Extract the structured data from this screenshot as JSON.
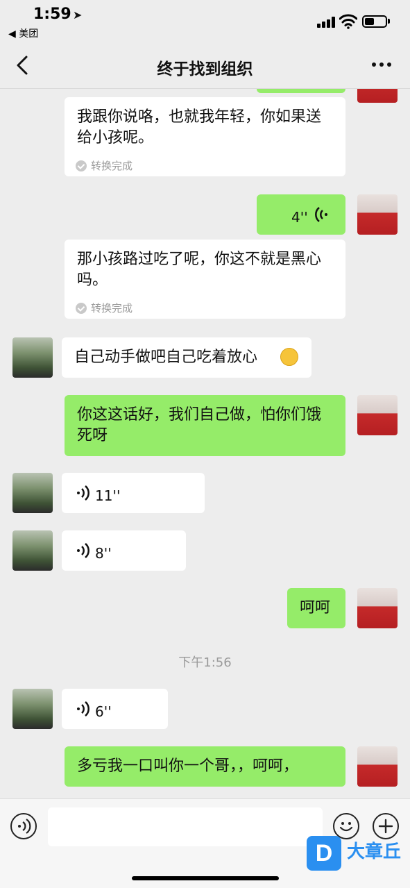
{
  "status_bar": {
    "time": "1:59",
    "location_arrow": "➤",
    "back_app": "◀ 美团"
  },
  "nav": {
    "title": "终于找到组织"
  },
  "messages": {
    "conv1_text": "我跟你说咯，也就我年轻，你如果送给小孩呢。",
    "conv1_status": "转换完成",
    "voice_me_duration": "4''",
    "conv2_text": "那小孩路过吃了呢，你这不就是黑心吗。",
    "conv2_status": "转换完成",
    "other_text1": "自己动手做吧自己吃着放心",
    "me_text1": "你这这话好，我们自己做，怕你们饿死呀",
    "voice_other1_duration": "11''",
    "voice_other2_duration": "8''",
    "me_text2": "呵呵",
    "timestamp": "下午1:56",
    "voice_other3_duration": "6''",
    "me_text3": "多亏我一口叫你一个哥，，呵呵，"
  },
  "input_bar": {
    "placeholder": ""
  },
  "watermark": {
    "logo_letter": "D",
    "text": "大章丘"
  },
  "colors": {
    "background": "#ededed",
    "bubble_me": "#95ec69",
    "bubble_other": "#ffffff",
    "watermark": "#2a8ff0"
  }
}
